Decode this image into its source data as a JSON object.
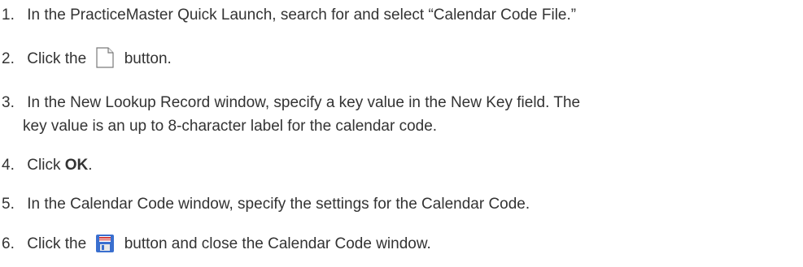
{
  "steps": [
    {
      "number": "1.",
      "text": "In the PracticeMaster Quick Launch, search for and select “Calendar Code File.”"
    },
    {
      "number": "2.",
      "before": "Click the",
      "icon": "new-document-icon",
      "after": "button."
    },
    {
      "number": "3.",
      "line1": "In the New Lookup Record window, specify a key value in the New Key field. The",
      "line2": "key value is an up to 8-character label for the calendar code."
    },
    {
      "number": "4.",
      "before": "Click ",
      "bold": "OK",
      "after": "."
    },
    {
      "number": "5.",
      "text": "In the Calendar Code window, specify the settings for the Calendar Code."
    },
    {
      "number": "6.",
      "before": "Click the",
      "icon": "save-icon",
      "after": "button and close the Calendar Code window."
    }
  ],
  "colors": {
    "text": "#333333",
    "save_icon_blue": "#3a6fcf",
    "save_icon_red": "#d23a3a",
    "new_icon_outline": "#7a7a7a"
  }
}
